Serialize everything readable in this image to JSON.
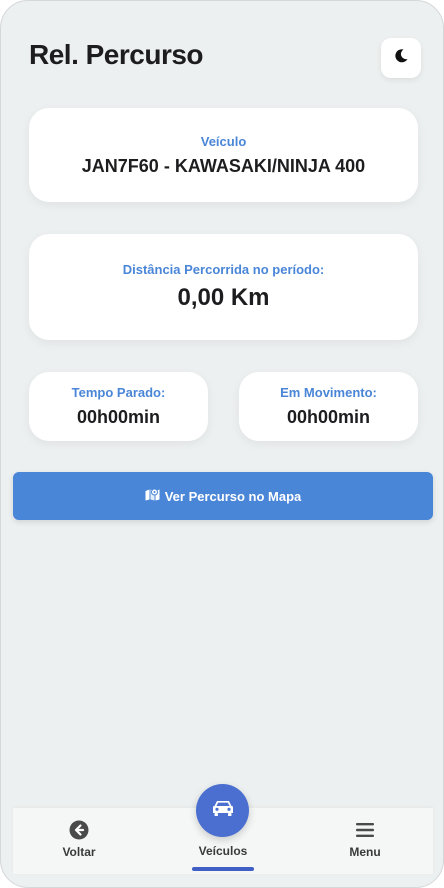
{
  "header": {
    "title": "Rel. Percurso",
    "theme_toggle_icon": "moon-icon"
  },
  "vehicle_card": {
    "label": "Veículo",
    "value": "JAN7F60 - KAWASAKI/NINJA 400"
  },
  "distance_card": {
    "label": "Distância Percorrida no período:",
    "value": "0,00 Km"
  },
  "stopped_card": {
    "label": "Tempo Parado:",
    "value": "00h00min"
  },
  "moving_card": {
    "label": "Em Movimento:",
    "value": "00h00min"
  },
  "map_button": {
    "label": "Ver Percurso no Mapa",
    "icon": "map-icon"
  },
  "bottom_nav": {
    "back": {
      "label": "Voltar",
      "icon": "arrow-left-circle-icon"
    },
    "vehicles": {
      "label": "Veículos",
      "icon": "car-icon",
      "active": true
    },
    "menu": {
      "label": "Menu",
      "icon": "menu-icon"
    }
  },
  "colors": {
    "accent": "#4a86d8",
    "fab": "#4a6fd0",
    "background": "#edf0f0",
    "card": "#ffffff",
    "text": "#1d1d1f"
  }
}
